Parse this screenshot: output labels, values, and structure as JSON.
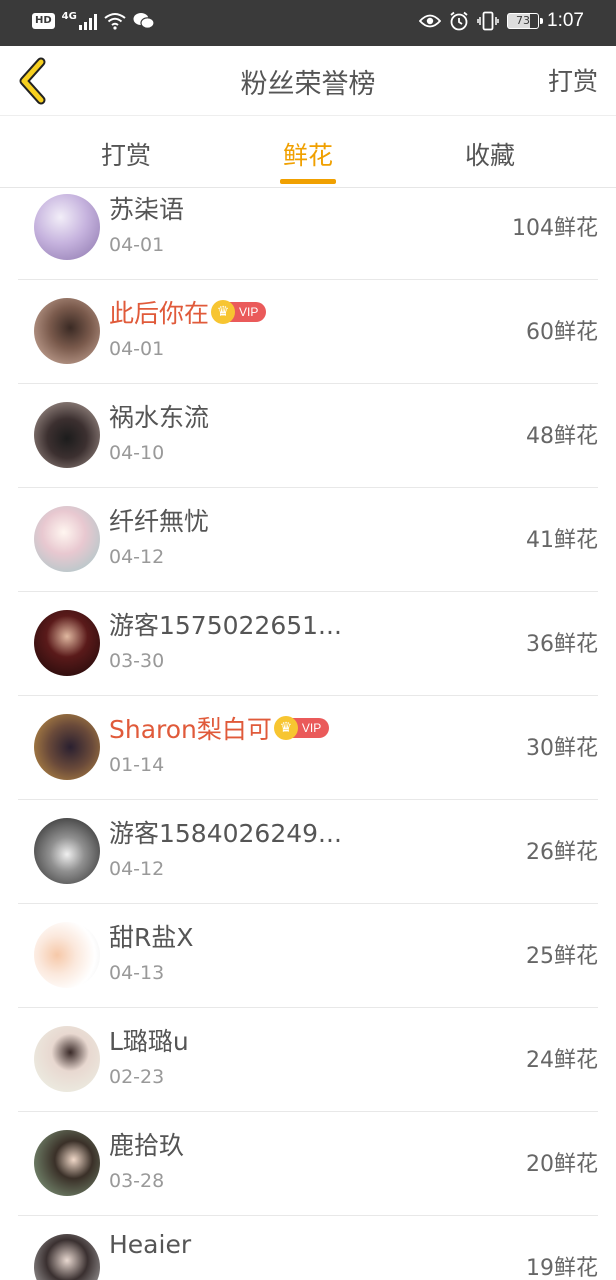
{
  "status_bar": {
    "left_badge": "HD",
    "network": "4G",
    "battery": "73",
    "time": "1:07",
    "icons": [
      "wifi-icon",
      "wechat-icon",
      "eye-icon",
      "alarm-icon",
      "vibrate-icon"
    ]
  },
  "nav": {
    "title": "粉丝荣誉榜",
    "action": "打赏",
    "back_icon": "back-chevron-icon",
    "accent_color": "#f0a000"
  },
  "tabs": [
    {
      "label": "打赏",
      "active": false
    },
    {
      "label": "鲜花",
      "active": true
    },
    {
      "label": "收藏",
      "active": false
    }
  ],
  "list": [
    {
      "name": "苏柒语",
      "date": "04-01",
      "count": "104鲜花",
      "vip": false
    },
    {
      "name": "此后你在",
      "date": "04-01",
      "count": "60鲜花",
      "vip": true,
      "badge": "VIP"
    },
    {
      "name": "祸水东流",
      "date": "04-10",
      "count": "48鲜花",
      "vip": false
    },
    {
      "name": "纤纤無忧",
      "date": "04-12",
      "count": "41鲜花",
      "vip": false
    },
    {
      "name": "游客1575022651...",
      "date": "03-30",
      "count": "36鲜花",
      "vip": false
    },
    {
      "name": "Sharon梨白可",
      "date": "01-14",
      "count": "30鲜花",
      "vip": true,
      "badge": "VIP"
    },
    {
      "name": "游客1584026249...",
      "date": "04-12",
      "count": "26鲜花",
      "vip": false
    },
    {
      "name": "甜R盐X",
      "date": "04-13",
      "count": "25鲜花",
      "vip": false
    },
    {
      "name": "L璐璐u",
      "date": "02-23",
      "count": "24鲜花",
      "vip": false
    },
    {
      "name": "鹿拾玖",
      "date": "03-28",
      "count": "20鲜花",
      "vip": false
    },
    {
      "name": "Heaier",
      "date": "",
      "count": "19鲜花",
      "vip": false
    }
  ]
}
